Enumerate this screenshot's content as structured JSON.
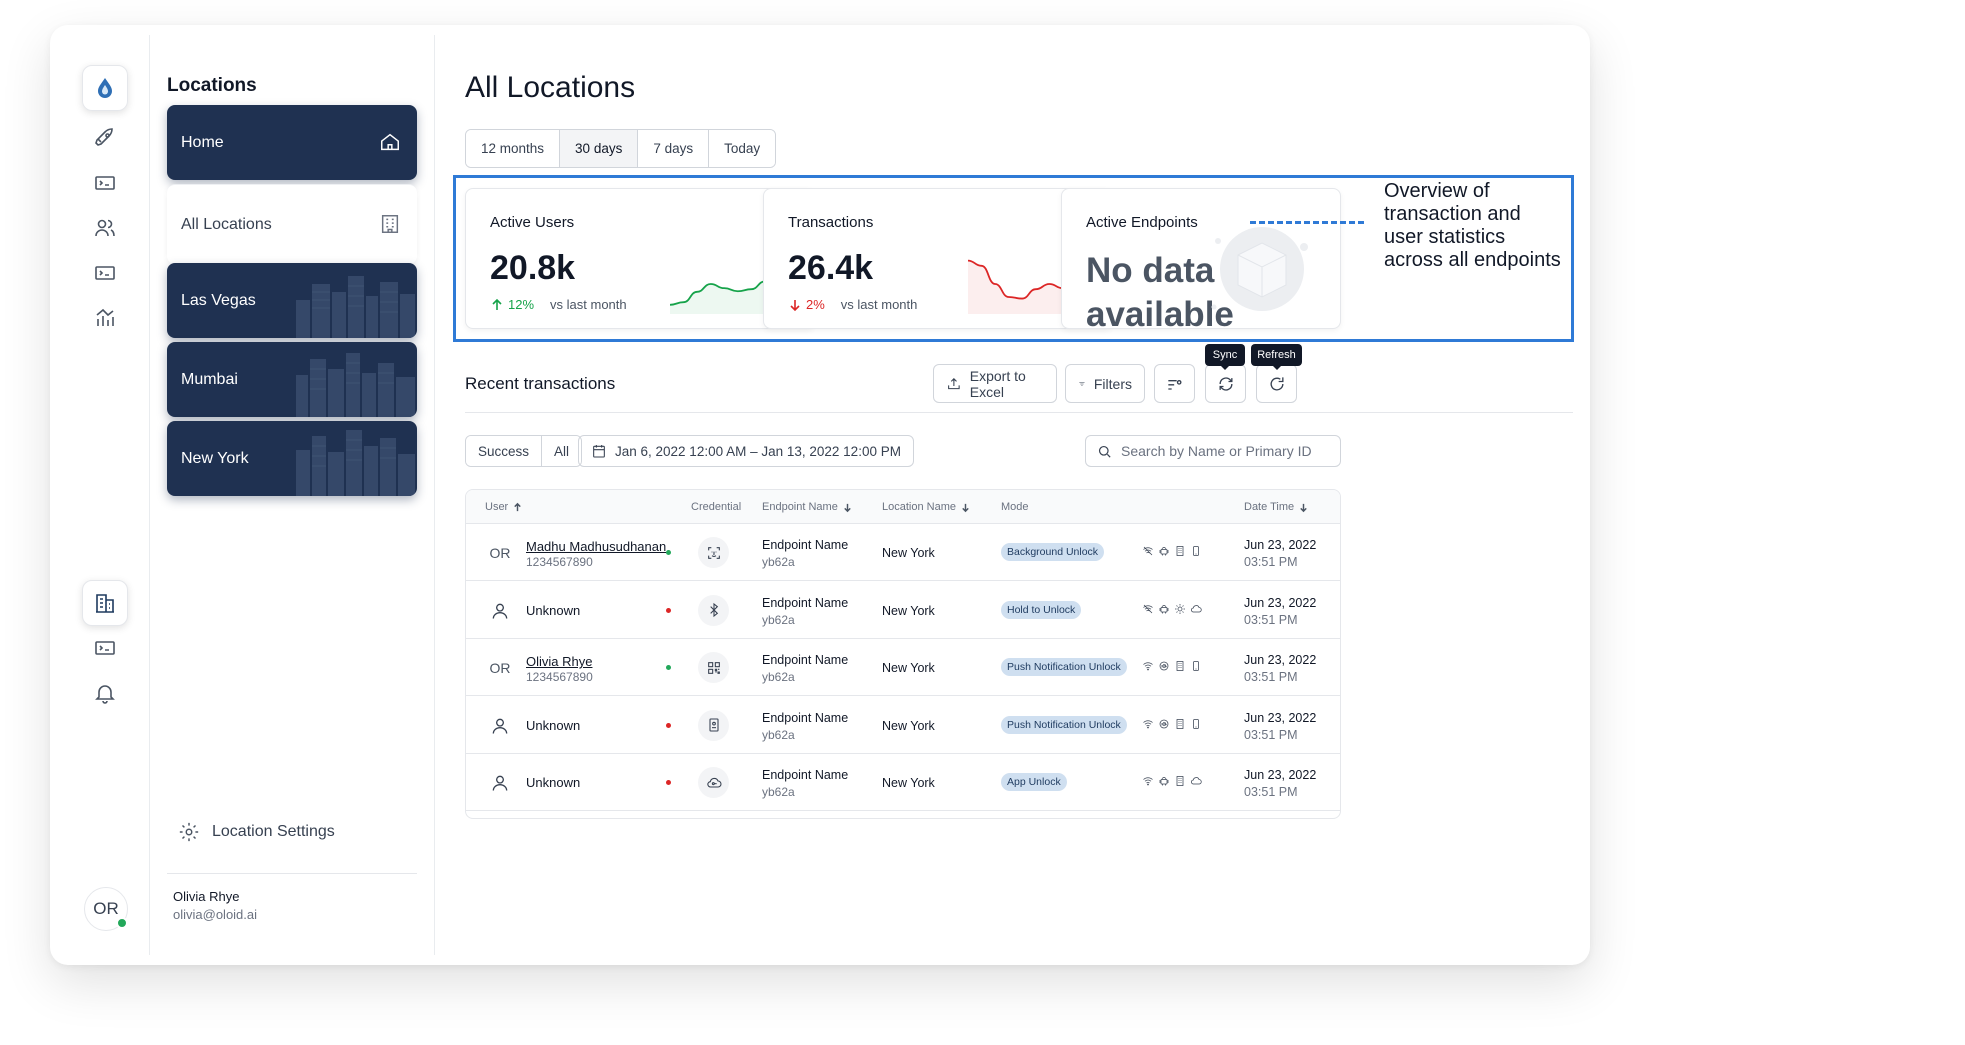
{
  "rail": {
    "items": [
      {
        "icon": "logo-drop-icon"
      },
      {
        "icon": "rocket-icon"
      },
      {
        "icon": "card-reader-icon"
      },
      {
        "icon": "users-icon"
      },
      {
        "icon": "card-reader-icon"
      },
      {
        "icon": "analytics-icon"
      },
      {
        "icon": "building-icon",
        "active": true
      },
      {
        "icon": "card-reader-icon"
      },
      {
        "icon": "bell-icon"
      }
    ],
    "avatar_initials": "OR"
  },
  "locations_panel": {
    "title": "Locations",
    "cards": [
      {
        "label": "Home",
        "style": "dark",
        "icon": "home-icon"
      },
      {
        "label": "All Locations",
        "style": "light",
        "icon": "building-icon"
      },
      {
        "label": "Las Vegas",
        "style": "dark"
      },
      {
        "label": "Mumbai",
        "style": "dark"
      },
      {
        "label": "New York",
        "style": "dark"
      }
    ],
    "settings_label": "Location Settings",
    "user": {
      "name": "Olivia Rhye",
      "email": "olivia@oloid.ai"
    }
  },
  "main": {
    "title": "All Locations",
    "period_tabs": [
      {
        "label": "12 months"
      },
      {
        "label": "30 days",
        "active": true
      },
      {
        "label": "7 days"
      },
      {
        "label": "Today"
      }
    ],
    "stats": {
      "active_users": {
        "label": "Active Users",
        "value": "20.8k",
        "delta": "12%",
        "direction": "up",
        "vs": "vs last month",
        "trend": [
          0.1,
          0.15,
          0.35,
          0.5,
          0.42,
          0.36,
          0.4,
          0.55,
          0.85,
          0.95
        ]
      },
      "transactions": {
        "label": "Transactions",
        "value": "26.4k",
        "delta": "2%",
        "direction": "down",
        "vs": "vs last month",
        "trend": [
          0.95,
          0.85,
          0.5,
          0.25,
          0.22,
          0.4,
          0.5,
          0.42,
          0.2,
          0.05
        ]
      },
      "active_endpoints": {
        "label": "Active Endpoints",
        "value": "No data available"
      }
    },
    "recent": {
      "title": "Recent transactions",
      "export_label": "Export to Excel",
      "filters_label": "Filters",
      "sync_tooltip": "Sync",
      "refresh_tooltip": "Refresh",
      "status_tabs": [
        {
          "label": "Success"
        },
        {
          "label": "All",
          "active": true
        }
      ],
      "date_range": "Jan 6, 2022 12:00 AM – Jan 13, 2022 12:00 PM",
      "search_placeholder": "Search by Name or Primary ID",
      "columns": {
        "user": "User",
        "credential": "Credential",
        "endpoint": "Endpoint Name",
        "location": "Location Name",
        "mode": "Mode",
        "datetime": "Date Time"
      },
      "rows": [
        {
          "avatar": "OR",
          "name": "Madhu Madhusudhanan",
          "id": "1234567890",
          "linked": true,
          "status": "success",
          "credential_icon": "face-id-icon",
          "endpoint": "Endpoint Name",
          "endpoint_id": "yb62a",
          "location": "New York",
          "mode": "Background Unlock",
          "capabilities": [
            "wifi-off-icon",
            "android-icon",
            "building-icon",
            "phone-icon"
          ],
          "date": "Jun 23, 2022",
          "time": "03:51 PM"
        },
        {
          "avatar": "",
          "name": "Unknown",
          "id": "",
          "linked": false,
          "status": "failed",
          "credential_icon": "bluetooth-icon",
          "endpoint": "Endpoint Name",
          "endpoint_id": "yb62a",
          "location": "New York",
          "mode": "Hold to Unlock",
          "capabilities": [
            "wifi-off-icon",
            "android-icon",
            "sun-icon",
            "cloud-icon"
          ],
          "date": "Jun 23, 2022",
          "time": "03:51 PM"
        },
        {
          "avatar": "OR",
          "name": "Olivia Rhye",
          "id": "1234567890",
          "linked": true,
          "status": "success",
          "credential_icon": "qr-code-icon",
          "endpoint": "Endpoint Name",
          "endpoint_id": "yb62a",
          "location": "New York",
          "mode": "Push Notification Unlock",
          "capabilities": [
            "wifi-icon",
            "ios-icon",
            "building-icon",
            "phone-icon"
          ],
          "date": "Jun 23, 2022",
          "time": "03:51 PM"
        },
        {
          "avatar": "",
          "name": "Unknown",
          "id": "",
          "linked": false,
          "status": "failed",
          "credential_icon": "badge-icon",
          "endpoint": "Endpoint Name",
          "endpoint_id": "yb62a",
          "location": "New York",
          "mode": "Push Notification Unlock",
          "capabilities": [
            "wifi-icon",
            "ios-icon",
            "building-icon",
            "phone-icon"
          ],
          "date": "Jun 23, 2022",
          "time": "03:51 PM"
        },
        {
          "avatar": "",
          "name": "Unknown",
          "id": "",
          "linked": false,
          "status": "failed",
          "credential_icon": "cloud-key-icon",
          "endpoint": "Endpoint Name",
          "endpoint_id": "yb62a",
          "location": "New York",
          "mode": "App Unlock",
          "capabilities": [
            "wifi-icon",
            "android-icon",
            "building-icon",
            "cloud-icon"
          ],
          "date": "Jun 23, 2022",
          "time": "03:51 PM"
        }
      ]
    }
  },
  "annotation": {
    "text": "Overview of transaction and user statistics across all endpoints",
    "color": "#2f7ad6"
  },
  "colors": {
    "navy": "#1f3151",
    "accent_blue": "#2f7ad6",
    "success": "#22a85a",
    "danger": "#dc2626",
    "badge_bg": "#cfdff0"
  }
}
